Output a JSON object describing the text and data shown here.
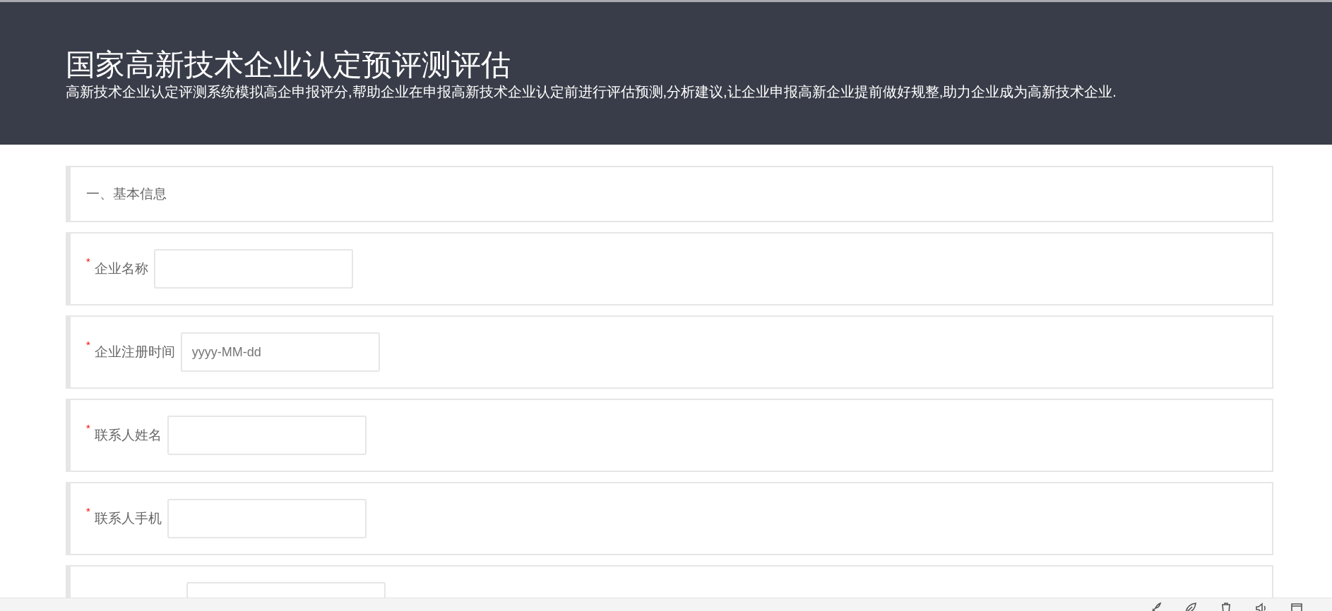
{
  "header": {
    "title": "国家高新技术企业认定预评测评估",
    "subtitle": "高新技术企业认定评测系统模拟高企申报评分,帮助企业在申报高新技术企业认定前进行评估预测,分析建议,让企业申报高新企业提前做好规整,助力企业成为高新技术企业."
  },
  "section": {
    "heading": "一、基本信息"
  },
  "fields": [
    {
      "kind": "labeled",
      "mark": "*",
      "label": "企业名称"
    },
    {
      "kind": "labeled",
      "mark": "*",
      "label": "企业注册时间",
      "placeholder": "yyyy-MM-dd"
    },
    {
      "kind": "labeled",
      "mark": "*",
      "label": "联系人姓名"
    },
    {
      "kind": "labeled",
      "mark": "*",
      "label": "联系人手机"
    },
    {
      "kind": "cut_off"
    }
  ]
}
